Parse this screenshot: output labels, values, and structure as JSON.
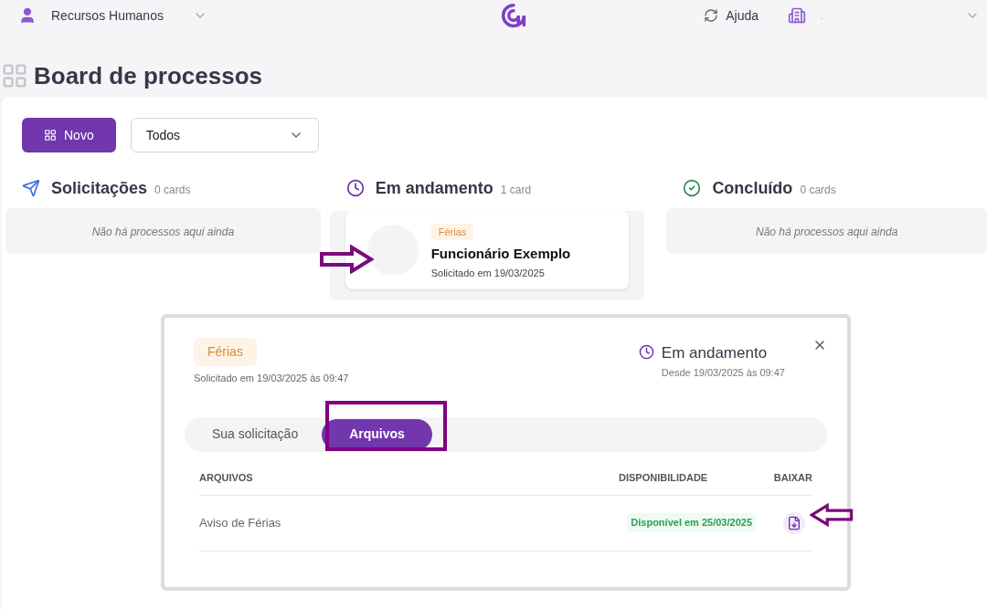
{
  "topbar": {
    "department": "Recursos Humanos",
    "help": "Ajuda",
    "company": "."
  },
  "page": {
    "title": "Board de processos"
  },
  "toolbar": {
    "new_button": "Novo",
    "filter": {
      "value": "Todos"
    }
  },
  "columns": [
    {
      "kind": "sent",
      "title": "Solicitações",
      "count": "0 cards",
      "empty": "Não há processos aqui ainda"
    },
    {
      "kind": "progress",
      "title": "Em andamento",
      "count": "1 card",
      "cards": [
        {
          "tag": "Férias",
          "name": "Funcionário Exemplo",
          "date": "Solicitado em 19/03/2025"
        }
      ]
    },
    {
      "kind": "done",
      "title": "Concluído",
      "count": "0 cards",
      "empty": "Não há processos aqui ainda"
    }
  ],
  "dialog": {
    "tag": "Férias",
    "requested": "Solicitado em 19/03/2025 às 09:47",
    "status": "Em andamento",
    "since": "Desde 19/03/2025 às 09:47",
    "tabs": [
      {
        "label": "Sua solicitação",
        "selected": false
      },
      {
        "label": "Arquivos",
        "selected": true
      }
    ],
    "table": {
      "columns": [
        "ARQUIVOS",
        "DISPONIBILIDADE",
        "BAIXAR"
      ],
      "rows": [
        {
          "file": "Aviso de Férias",
          "availability": "Disponível em 25/03/2025"
        }
      ]
    }
  }
}
